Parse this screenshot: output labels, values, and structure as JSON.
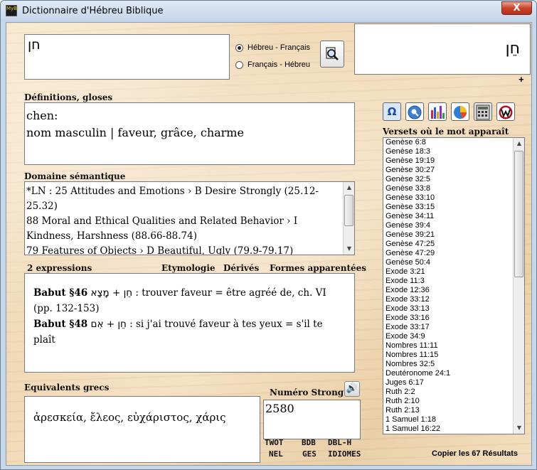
{
  "window": {
    "title": "Dictionnaire d'Hébreu Biblique",
    "close_label": "X",
    "app_icon_text": "MyBi"
  },
  "search": {
    "value": "חן",
    "radio_options": [
      {
        "label": "Hébreu - Français",
        "selected": true
      },
      {
        "label": "Français - Hébreu",
        "selected": false
      }
    ],
    "find_icon": "magnifier-icon",
    "display_word": "חֵן",
    "add_label": "+"
  },
  "definitions": {
    "label": "Définitions, gloses",
    "line1": "chen:",
    "line2": "nom masculin   | faveur, grâce, charme"
  },
  "domain": {
    "label": "Domaine sémantique",
    "lines": [
      "*LN : 25 Attitudes and Emotions › B Desire Strongly (25.12-25.32)",
      "88 Moral and Ethical Qualities and Related Behavior › I Kindness, Harshness (88.66-88.74)",
      "79 Features of Objects › D Beautiful, Ugly (79.9-79.17)"
    ]
  },
  "expressions": {
    "count_label": "2 expressions",
    "tabs": [
      "Etymologie",
      "Dérivés",
      "Formes apparentées"
    ],
    "items": [
      {
        "ref": "Babut §46",
        "hebrew": "חֵן + מָצָא",
        "text": " : trouver faveur = être agréé de, ch. VI (pp. 132-153)"
      },
      {
        "ref": "Babut §48",
        "hebrew": "חֵן + אִם",
        "text": " : si j'ai trouvé faveur à tes yeux = s'il te plaît"
      }
    ]
  },
  "greek": {
    "label": "Equivalents grecs",
    "text": "ἀρεσκεία, ἔλεος, εὐχάριστος, χάρις"
  },
  "strong": {
    "label": "Numéro Strong",
    "value": "2580",
    "button_icon": "speaker-icon",
    "links_row1": [
      "TWOT",
      "BDB",
      "DBL-H"
    ],
    "links_row2": [
      "NEL",
      "GES",
      "IDIOMES"
    ]
  },
  "toolbar": {
    "icons": [
      {
        "name": "omega-icon",
        "glyph": "Ω",
        "bg": "#d8e6f5",
        "fg": "#1d4f9a"
      },
      {
        "name": "search-globe-icon",
        "glyph": "⌕",
        "bg": "#5b8fd6",
        "fg": "#ffffff"
      },
      {
        "name": "bar-chart-icon",
        "glyph": "▮",
        "bg": "#ffffff",
        "fg": "#c0185a"
      },
      {
        "name": "pie-chart-icon",
        "glyph": "◔",
        "bg": "#ffffff",
        "fg": "#2c7fd6"
      },
      {
        "name": "calculator-icon",
        "glyph": "▦",
        "bg": "#e0e0e0",
        "fg": "#333333"
      },
      {
        "name": "w-logo-icon",
        "glyph": "W",
        "bg": "#ffffff",
        "fg": "#b0121e"
      }
    ]
  },
  "verses": {
    "label": "Versets où le mot apparaît",
    "items": [
      "Genèse 6:8",
      "Genèse 18:3",
      "Genèse 19:19",
      "Genèse 30:27",
      "Genèse 32:5",
      "Genèse 33:8",
      "Genèse 33:10",
      "Genèse 33:15",
      "Genèse 34:11",
      "Genèse 39:4",
      "Genèse 39:21",
      "Genèse 47:25",
      "Genèse 47:29",
      "Genèse 50:4",
      "Exode 3:21",
      "Exode 11:3",
      "Exode 12:36",
      "Exode 33:12",
      "Exode 33:13",
      "Exode 33:16",
      "Exode 33:17",
      "Exode 34:9",
      "Nombres 11:11",
      "Nombres 11:15",
      "Nombres 32:5",
      "Deutéronome 24:1",
      "Juges 6:17",
      "Ruth 2:2",
      "Ruth 2:10",
      "Ruth 2:13",
      "1 Samuel 1:18",
      "1 Samuel 16:22"
    ],
    "copy_label": "Copier les 67 Résultats"
  }
}
